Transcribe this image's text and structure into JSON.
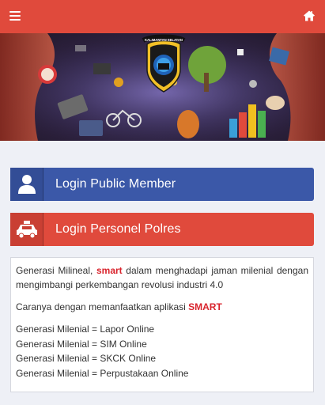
{
  "header": {
    "menu_icon": "hamburger-menu-icon",
    "home_icon": "home-icon",
    "color": "#e04a3c"
  },
  "banner": {
    "logo_text": "KALIMANTAN SELATAN"
  },
  "buttons": {
    "public": {
      "label": "Login Public Member",
      "icon": "user-icon",
      "color": "#3b58a8"
    },
    "personel": {
      "label": "Login Personel Polres",
      "icon": "car-icon",
      "color": "#e04a3c"
    }
  },
  "info": {
    "p1_before": "Generasi Milineal, ",
    "p1_highlight": "smart",
    "p1_after": " dalam menghadapi jaman milenial dengan mengimbangi perkembangan revolusi industri 4.0",
    "p2_before": "Caranya dengan memanfaatkan aplikasi ",
    "p2_highlight": "SMART",
    "items": [
      "Generasi Milenial = Lapor Online",
      "Generasi Milenial = SIM Online",
      "Generasi Milenial = SKCK Online",
      "Generasi Milenial = Perpustakaan Online"
    ]
  }
}
